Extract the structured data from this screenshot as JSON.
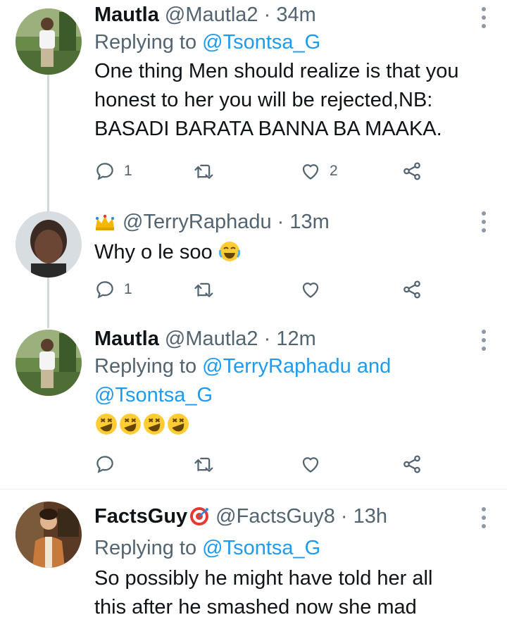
{
  "tweets": [
    {
      "name": "Mautla",
      "handle": "@Mautla2",
      "time": "34m",
      "replying_prefix": "Replying to",
      "replying_to": "@Tsontsa_G",
      "body_lines": [
        "One thing Men should realize is that you",
        "honest to her  you will be rejected,NB:",
        "BASADI BARATA BANNA BA MAAKA."
      ],
      "reply_count": "1",
      "retweet_count": "",
      "like_count": "2"
    },
    {
      "name": "",
      "handle": "@TerryRaphadu",
      "time": "13m",
      "body_text": "Why o le soo",
      "reply_count": "1",
      "retweet_count": "",
      "like_count": ""
    },
    {
      "name": "Mautla",
      "handle": "@Mautla2",
      "time": "12m",
      "replying_prefix": "Replying to",
      "replying_to_1": "@TerryRaphadu",
      "replying_and": "and",
      "replying_to_2": "@Tsontsa_G",
      "reply_count": "",
      "retweet_count": "",
      "like_count": ""
    },
    {
      "name": "FactsGuy",
      "handle": "@FactsGuy8",
      "time": "13h",
      "replying_prefix": "Replying to",
      "replying_to": "@Tsontsa_G",
      "body_lines": [
        "So possibly he might have told her all",
        "this after he smashed now she mad"
      ]
    }
  ],
  "separator": "·",
  "colors": {
    "text": "#0f1419",
    "secondary": "#536471",
    "link": "#1d9bf0",
    "thread_line": "#cfd9de"
  },
  "icons": [
    "reply-icon",
    "retweet-icon",
    "like-icon",
    "share-icon",
    "more-icon",
    "crown-emoji",
    "laughing-emoji",
    "rolling-laughing-emoji",
    "target-emoji"
  ]
}
